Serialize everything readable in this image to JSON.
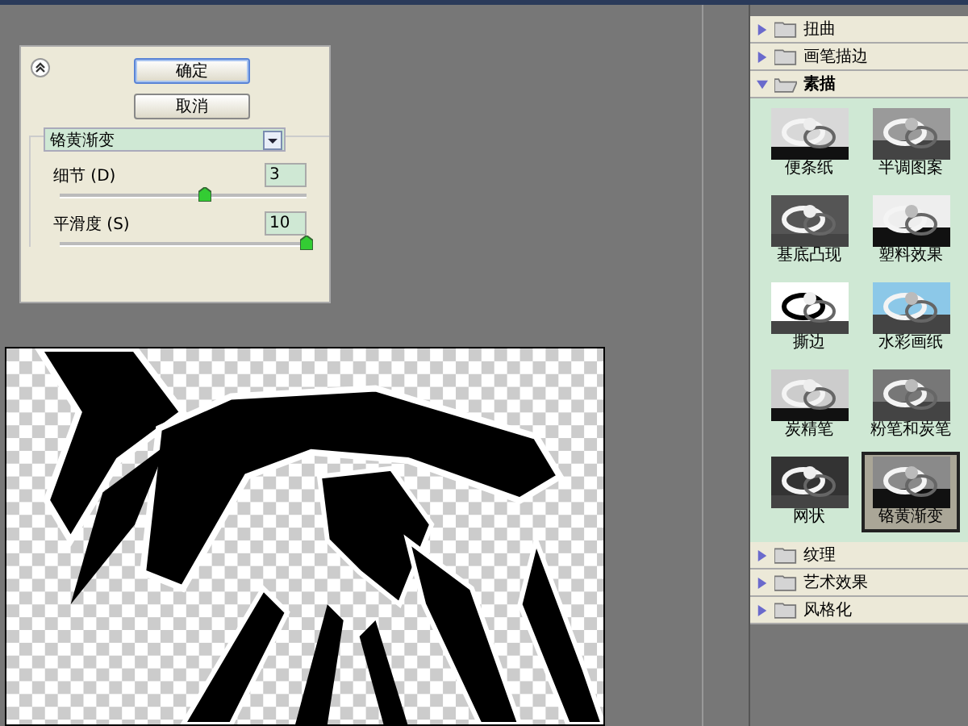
{
  "buttons": [
    {
      "label": "确定",
      "default": true
    },
    {
      "label": "取消",
      "default": false
    }
  ],
  "filter_select": {
    "value": "铬黄渐变"
  },
  "sliders": [
    {
      "label": "细节 (D)",
      "value": "3",
      "level": 0.59
    },
    {
      "label": "平滑度 (S)",
      "value": "10",
      "level": 1
    }
  ],
  "categories": [
    {
      "name": "扭曲",
      "expanded": false
    },
    {
      "name": "画笔描边",
      "expanded": false
    },
    {
      "name": "素描",
      "expanded": true,
      "filters": [
        {
          "name": "便条纸",
          "selected": false
        },
        {
          "name": "半调图案",
          "selected": false
        },
        {
          "name": "基底凸现",
          "selected": false
        },
        {
          "name": "塑料效果",
          "selected": false
        },
        {
          "name": "撕边",
          "selected": false
        },
        {
          "name": "水彩画纸",
          "selected": false
        },
        {
          "name": "炭精笔",
          "selected": false
        },
        {
          "name": "粉笔和炭笔",
          "selected": false
        },
        {
          "name": "网状",
          "selected": false
        },
        {
          "name": "铬黄渐变",
          "selected": true
        }
      ]
    },
    {
      "name": "纹理",
      "expanded": false
    },
    {
      "name": "艺术效果",
      "expanded": false
    },
    {
      "name": "风格化",
      "expanded": false
    }
  ]
}
